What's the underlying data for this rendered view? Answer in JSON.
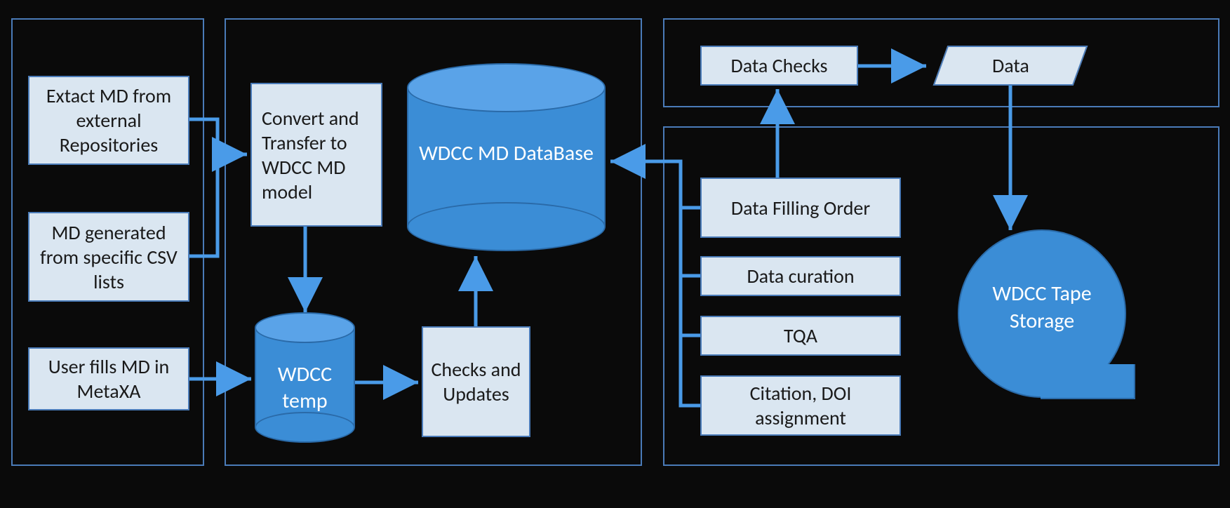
{
  "boxes": {
    "extract": "Extact MD from external Repositories",
    "generated": "MD generated from specific CSV lists",
    "userfills": "User fills MD in MetaXA",
    "convert": "Convert and Transfer to WDCC MD model",
    "wdcctemp": "WDCC temp",
    "checks": "Checks and Updates",
    "wdccdb": "WDCC MD DataBase",
    "datachecks": "Data Checks",
    "data": "Data",
    "filling": "Data Filling Order",
    "curation": "Data curation",
    "tqa": "TQA",
    "citation": "Citation, DOI assignment",
    "tape": "WDCC Tape Storage"
  }
}
